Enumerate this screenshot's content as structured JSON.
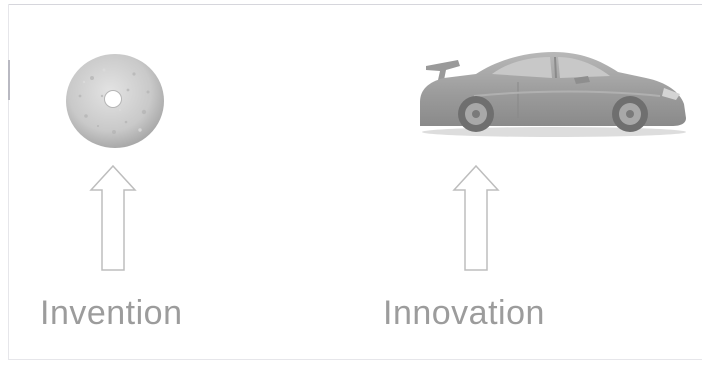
{
  "slide": {
    "labels": {
      "invention": "Invention",
      "innovation": "Innovation"
    },
    "images": {
      "left": "stone-wheel",
      "right": "sports-car"
    },
    "icons": {
      "left_arrow": "up-arrow-icon",
      "right_arrow": "up-arrow-icon"
    },
    "colors": {
      "caption": "#9c9c9c",
      "arrow_outline": "#bdbdbd",
      "background": "#ffffff"
    }
  }
}
